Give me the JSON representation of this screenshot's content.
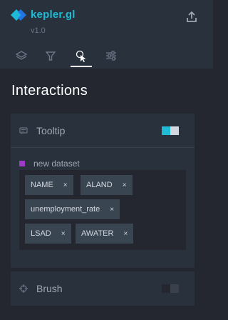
{
  "app": {
    "name": "kepler.gl",
    "version": "v1.0"
  },
  "header": {
    "share_icon": "share-icon"
  },
  "tabs": [
    {
      "name": "layers",
      "icon": "layers-icon",
      "active": false
    },
    {
      "name": "filters",
      "icon": "filter-icon",
      "active": false
    },
    {
      "name": "interactions",
      "icon": "cursor-click-icon",
      "active": true
    },
    {
      "name": "map-style",
      "icon": "sliders-icon",
      "active": false
    }
  ],
  "page_title": "Interactions",
  "tooltip_panel": {
    "label": "Tooltip",
    "enabled": true,
    "dataset": {
      "name": "new dataset",
      "color": "#9b3bc6"
    },
    "fields": [
      "NAME",
      "ALAND",
      "unemployment_rate",
      "LSAD",
      "AWATER"
    ],
    "remove_glyph": "×"
  },
  "brush_panel": {
    "label": "Brush",
    "enabled": false
  },
  "colors": {
    "accent": "#1fbad6",
    "panel_bg": "#29323c",
    "page_bg": "#242730"
  }
}
